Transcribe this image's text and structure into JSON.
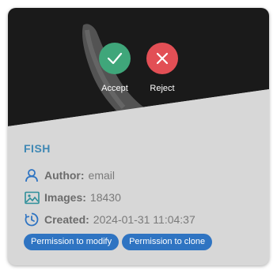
{
  "actions": {
    "accept_label": "Accept",
    "reject_label": "Reject"
  },
  "card": {
    "title": "FISH",
    "author": {
      "label": "Author:",
      "value": "email"
    },
    "images": {
      "label": "Images:",
      "value": "18430"
    },
    "created": {
      "label": "Created:",
      "value": "2024-01-31 11:04:37"
    },
    "badges": [
      "Permission to modify",
      "Permission to clone"
    ]
  },
  "colors": {
    "accept": "#3fa67a",
    "reject": "#e24f55",
    "title": "#3f88b4",
    "badge": "#2f74c2",
    "preview_bg": "#1a1a1a",
    "card_bg": "#d7d7d7",
    "icon": "#2f74c2",
    "icon_images": "#2f8f9a"
  },
  "icons": {
    "accept": "check-icon",
    "reject": "close-icon",
    "author": "user-icon",
    "images": "image-icon",
    "created": "clock-icon"
  }
}
